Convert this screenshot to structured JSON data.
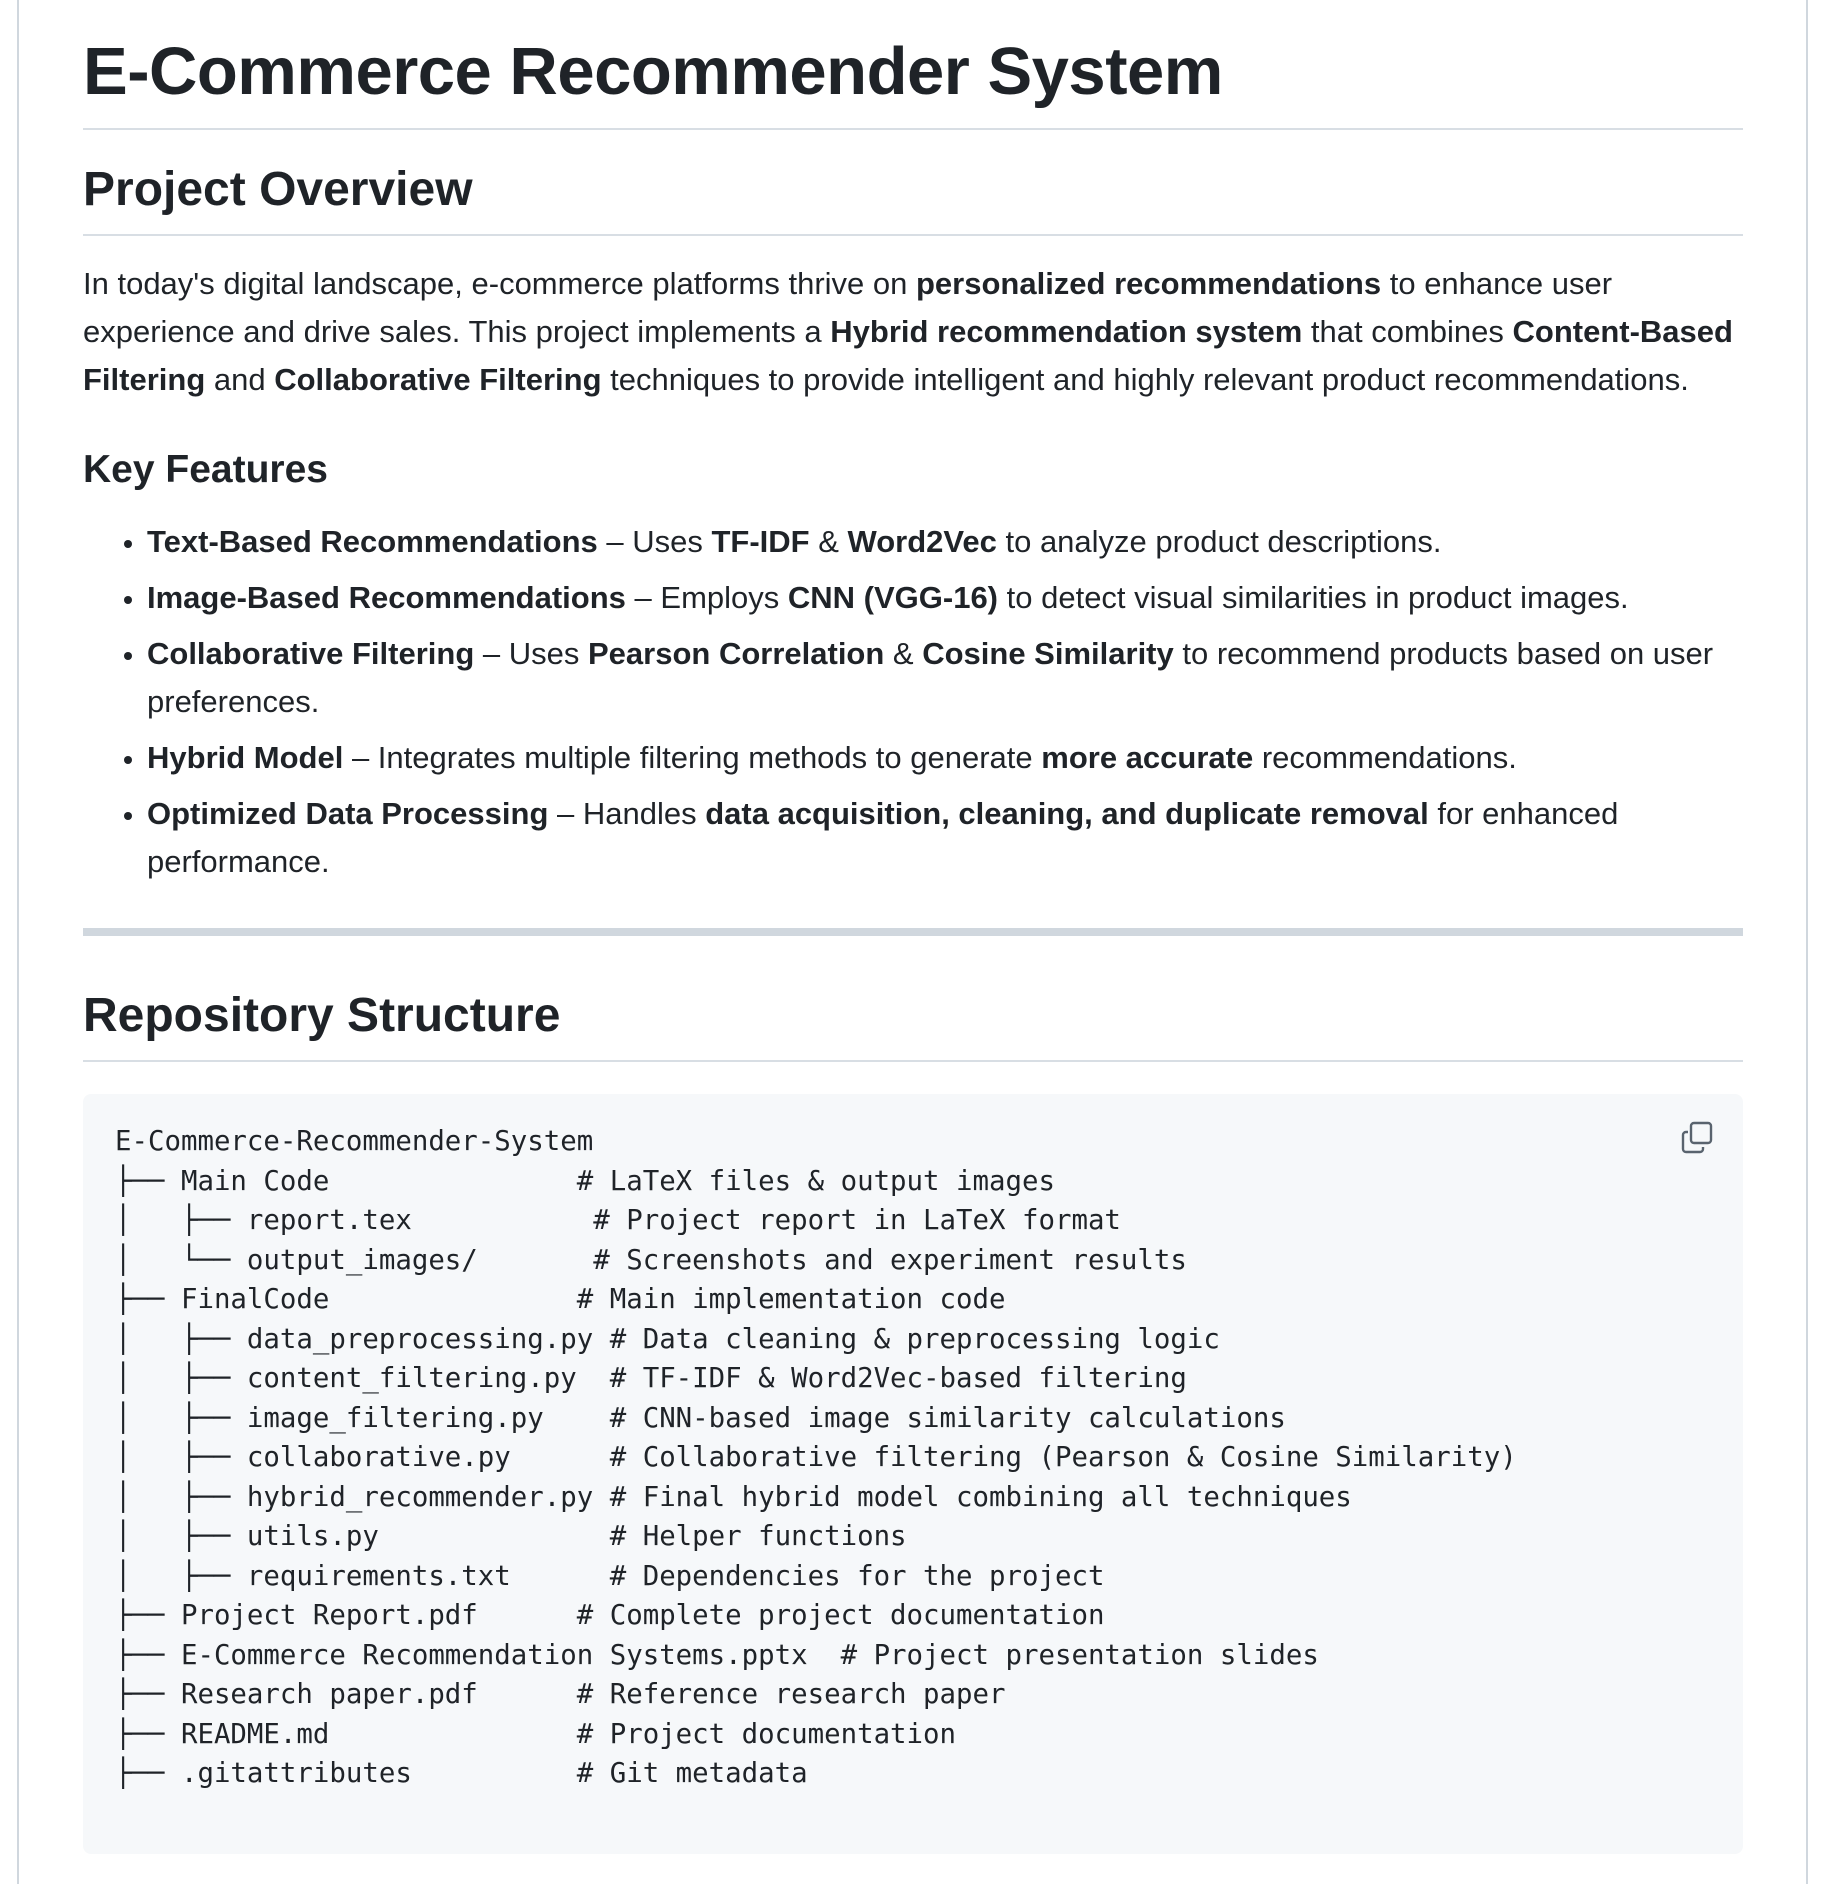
{
  "title": "E-Commerce Recommender System",
  "overview": {
    "heading": "Project Overview",
    "paragraph": {
      "t1": "In today's digital landscape, e-commerce platforms thrive on ",
      "b1": "personalized recommendations",
      "t2": " to enhance user experience and drive sales. This project implements a ",
      "b2": "Hybrid recommendation system",
      "t3": " that combines ",
      "b3": "Content-Based Filtering",
      "t4": " and ",
      "b4": "Collaborative Filtering",
      "t5": " techniques to provide intelligent and highly relevant product recommendations."
    }
  },
  "features": {
    "heading": "Key Features",
    "items": [
      {
        "b1": "Text-Based Recommendations",
        "t1": " – Uses ",
        "b2": "TF-IDF",
        "t2": " & ",
        "b3": "Word2Vec",
        "t3": " to analyze product descriptions."
      },
      {
        "b1": "Image-Based Recommendations",
        "t1": " – Employs ",
        "b2": "CNN (VGG-16)",
        "t2": " to detect visual similarities in product images."
      },
      {
        "b1": "Collaborative Filtering",
        "t1": " – Uses ",
        "b2": "Pearson Correlation",
        "t2": " & ",
        "b3": "Cosine Similarity",
        "t3": " to recommend products based on user preferences."
      },
      {
        "b1": "Hybrid Model",
        "t1": " – Integrates multiple filtering methods to generate ",
        "b2": "more accurate",
        "t2": " recommendations."
      },
      {
        "b1": "Optimized Data Processing",
        "t1": " – Handles ",
        "b2": "data acquisition, cleaning, and duplicate removal",
        "t2": " for enhanced performance."
      }
    ]
  },
  "structure": {
    "heading": "Repository Structure",
    "copy_icon": "copy-icon",
    "code": "E-Commerce-Recommender-System\n├── Main Code               # LaTeX files & output images\n│   ├── report.tex           # Project report in LaTeX format\n│   └── output_images/       # Screenshots and experiment results\n├── FinalCode               # Main implementation code\n│   ├── data_preprocessing.py # Data cleaning & preprocessing logic\n│   ├── content_filtering.py  # TF-IDF & Word2Vec-based filtering\n│   ├── image_filtering.py    # CNN-based image similarity calculations\n│   ├── collaborative.py      # Collaborative filtering (Pearson & Cosine Similarity)\n│   ├── hybrid_recommender.py # Final hybrid model combining all techniques\n│   ├── utils.py              # Helper functions\n│   ├── requirements.txt      # Dependencies for the project\n├── Project Report.pdf      # Complete project documentation\n├── E-Commerce Recommendation Systems.pptx  # Project presentation slides\n├── Research paper.pdf      # Reference research paper\n├── README.md               # Project documentation\n├── .gitattributes          # Git metadata"
  }
}
